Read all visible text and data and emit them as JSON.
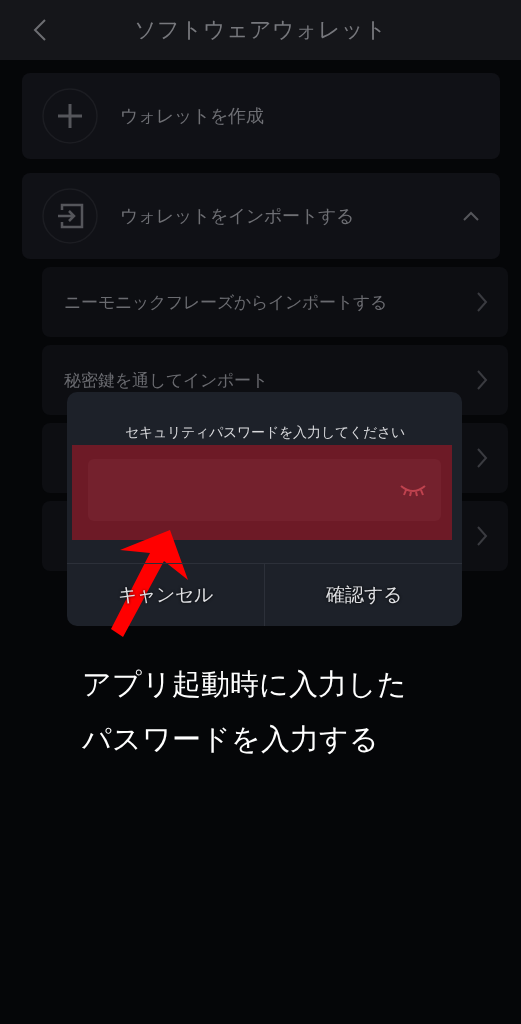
{
  "header": {
    "title": "ソフトウェアウォレット"
  },
  "menu": [
    {
      "kind": "create",
      "label": "ウォレットを作成"
    },
    {
      "kind": "import",
      "label": "ウォレットをインポートする",
      "expanded": true
    }
  ],
  "sub_items": [
    {
      "kind": "option",
      "label": "ニーモニックフレーズからインポートする"
    },
    {
      "kind": "option",
      "label": "秘密鍵を通してインポート"
    },
    {
      "kind": "option"
    },
    {
      "kind": "option"
    }
  ],
  "dialog": {
    "title": "セキュリティパスワードを入力してください",
    "password_visible": false,
    "buttons": [
      {
        "kind": "cancel",
        "label": "キャンセル"
      },
      {
        "kind": "confirm",
        "label": "確認する"
      }
    ]
  },
  "annotation": {
    "caption": [
      "アプリ起動時に入力した",
      "パスワードを入力する"
    ]
  }
}
